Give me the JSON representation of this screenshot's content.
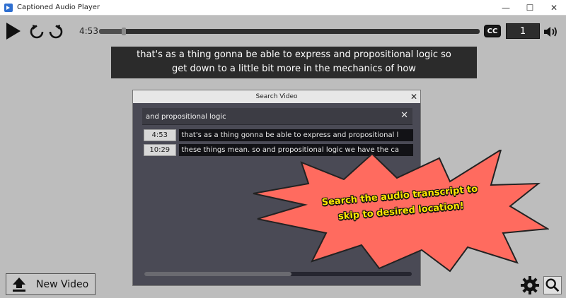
{
  "window": {
    "title": "Captioned Audio Player",
    "minimize": "—",
    "maximize": "☐",
    "close": "✕"
  },
  "player": {
    "current_time": "4:53",
    "progress_fraction": 0.065,
    "cc_label": "CC",
    "speed_value": "1"
  },
  "caption": {
    "line1": "that's as a thing gonna be able to express and propositional logic so",
    "line2": "get down to a little bit more in the mechanics of how"
  },
  "search_dialog": {
    "title": "Search Video",
    "close": "✕",
    "query": "and propositional logic",
    "clear": "✕",
    "results": [
      {
        "time": "4:53",
        "text": "that's as a thing gonna be able to express and propositional l"
      },
      {
        "time": "10:29",
        "text": "these things mean. so and propositional logic we have the ca"
      }
    ],
    "scroll_fraction": 0.55
  },
  "callout": {
    "line1": "Search the audio transcript to",
    "line2": "skip to desired location!",
    "fill": "#ff6b5f"
  },
  "bottom": {
    "new_video_label": "New Video"
  }
}
